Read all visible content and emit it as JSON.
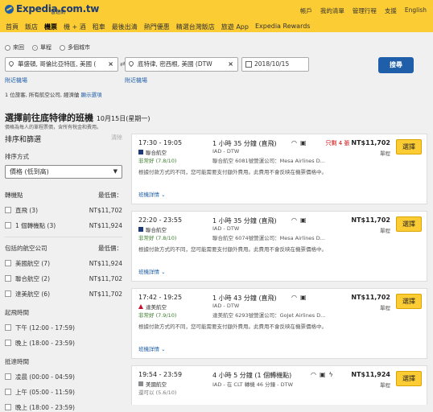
{
  "header": {
    "logo_text": "Expedia.com.tw",
    "logo_sub": "智遊網",
    "top_links": [
      "帳戶",
      "我的清單",
      "管理行程",
      "支援",
      "English"
    ],
    "nav": [
      "首頁",
      "飯店",
      "機票",
      "機 + 酒",
      "租車",
      "最後出清",
      "熱門優惠",
      "精選台灣飯店",
      "旅遊 App",
      "Expedia Rewards"
    ],
    "nav_active_index": 2
  },
  "search": {
    "trip_types": [
      "來回",
      "單程",
      "多個城市"
    ],
    "trip_type_selected": "單程",
    "origin": "華盛頓, 哥倫比亞特區, 美國 (",
    "destination": "底特律, 密西根, 美國 (DTW",
    "date": "2018/10/15",
    "search_button": "搜尋",
    "add_nearby_1": "附近機場",
    "add_nearby_2": "附近機場",
    "pax_summary": "1 位旅客, 所有航空公司, 經濟艙",
    "show_options": "顯示選項"
  },
  "results": {
    "title": "選擇前往底特律的班機",
    "date_note": "10月15日(星期一)",
    "price_note": "價格為每人的單程票價，含所有稅金和費用。"
  },
  "sidebar": {
    "title": "排序和篩選",
    "clear": "清除",
    "sort_label": "排序方式",
    "sort_value": "價格 (低到高)",
    "groups": [
      {
        "title": "轉機點",
        "price_header": "最低價：",
        "items": [
          {
            "label": "直飛 (3)",
            "price": "NT$11,702"
          },
          {
            "label": "1 個轉機點 (3)",
            "price": "NT$11,924"
          }
        ]
      },
      {
        "title": "包括的航空公司",
        "price_header": "最低價：",
        "items": [
          {
            "label": "美國航空 (7)",
            "price": "NT$11,924"
          },
          {
            "label": "聯合航空 (2)",
            "price": "NT$11,702"
          },
          {
            "label": "達美航空 (6)",
            "price": "NT$11,702"
          }
        ]
      },
      {
        "title": "起飛時間",
        "items": [
          {
            "label": "下午 (12:00 - 17:59)"
          },
          {
            "label": "晚上 (18:00 - 23:59)"
          }
        ]
      },
      {
        "title": "抵達時間",
        "items": [
          {
            "label": "凌晨 (00:00 - 04:59)"
          },
          {
            "label": "上午 (05:00 - 11:59)"
          },
          {
            "label": "晚上 (18:00 - 23:59)"
          }
        ]
      }
    ]
  },
  "flights": [
    {
      "time": "17:30 - 19:05",
      "duration": "1 小時 35 分鐘 (直飛)",
      "few_seats": "只剩 4 張",
      "price": "NT$11,702",
      "trip_type": "單程",
      "airline": "聯合航空",
      "rating": "非常好 (7.8/10)",
      "route": "IAD - DTW",
      "operated": "聯合航空 6081號營運公司：Mesa Airlines D...",
      "fee_note": "根據付款方式的不同，您可能需要支付額外費用。此費用不會反映在機票價格中。",
      "details": "班機詳情",
      "select": "選擇"
    },
    {
      "time": "22:20 - 23:55",
      "duration": "1 小時 35 分鐘 (直飛)",
      "few_seats": "",
      "price": "NT$11,702",
      "trip_type": "單程",
      "airline": "聯合航空",
      "rating": "非常好 (7.8/10)",
      "route": "IAD - DTW",
      "operated": "聯合航空 6074號營運公司：Mesa Airlines D...",
      "fee_note": "根據付款方式的不同，您可能需要支付額外費用。此費用不會反映在機票價格中。",
      "details": "班機詳情",
      "select": "選擇"
    },
    {
      "time": "17:42 - 19:25",
      "duration": "1 小時 43 分鐘 (直飛)",
      "few_seats": "",
      "price": "NT$11,702",
      "trip_type": "單程",
      "airline": "達美航空",
      "rating": "非常好 (7.9/10)",
      "route": "IAD - DTW",
      "operated": "達美航空 6293號營運公司：GoJet Airlines D...",
      "fee_note": "根據付款方式的不同，您可能需要支付額外費用。此費用不會反映在機票價格中。",
      "details": "班機詳情",
      "select": "選擇"
    },
    {
      "time": "19:54 - 23:59",
      "duration": "4 小時 5 分鐘 (1 個轉機點)",
      "few_seats": "",
      "price": "NT$11,924",
      "trip_type": "單程",
      "airline": "美國航空",
      "rating": "還可以 (5.6/10)",
      "route": "IAD - 在 CLT 轉機 46 分鐘 - DTW",
      "operated": "",
      "fee_note": "",
      "details": "",
      "select": "選擇"
    }
  ]
}
